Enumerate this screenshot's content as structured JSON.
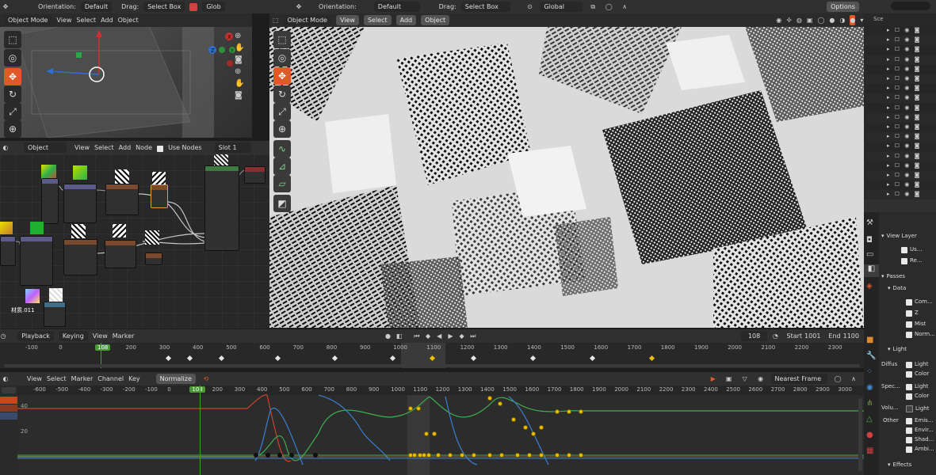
{
  "top_left_header": {
    "orientation_label": "Orientation:",
    "orientation_value": "Default",
    "drag_label": "Drag:",
    "drag_value": "Select Box",
    "transform_value": "Glob"
  },
  "top_right_header": {
    "orientation_label": "Orientation:",
    "orientation_value": "Default",
    "drag_label": "Drag:",
    "drag_value": "Select Box",
    "transform_value": "Global",
    "options_label": "Options"
  },
  "viewport_small": {
    "mode": "Object Mode",
    "menu": [
      "View",
      "Select",
      "Add",
      "Object"
    ]
  },
  "viewport_main": {
    "mode": "Object Mode",
    "menu": [
      "View",
      "Select",
      "Add",
      "Object"
    ]
  },
  "node_editor": {
    "mode": "Object",
    "menu": [
      "View",
      "Select",
      "Add",
      "Node"
    ],
    "use_nodes_label": "Use Nodes",
    "slot": "Slot 1",
    "material_label": "材质.011"
  },
  "timeline": {
    "menu": [
      "Playback",
      "Keying",
      "View",
      "Marker"
    ],
    "current_frame": "108",
    "start_label": "Start",
    "start_value": "1001",
    "end_label": "End",
    "end_value": "1100",
    "ticks": [
      "-100",
      "0",
      "108",
      "200",
      "300",
      "400",
      "500",
      "600",
      "700",
      "800",
      "900",
      "1000",
      "1100",
      "1200",
      "1300",
      "1400",
      "1500",
      "1600",
      "1700",
      "1800",
      "1900",
      "2000",
      "2100",
      "2200",
      "2300"
    ]
  },
  "graph_editor": {
    "menu": [
      "View",
      "Select",
      "Marker",
      "Channel",
      "Key"
    ],
    "normalize_label": "Normalize",
    "snap_value": "Nearest Frame",
    "current_frame": "108",
    "ticks": [
      "-600",
      "-500",
      "-400",
      "-300",
      "-200",
      "-100",
      "0",
      "108",
      "200",
      "300",
      "400",
      "500",
      "600",
      "700",
      "800",
      "900",
      "1000",
      "1100",
      "1200",
      "1300",
      "1400",
      "1500",
      "1600",
      "1700",
      "1800",
      "1900",
      "2000",
      "2100",
      "2200",
      "2300",
      "2400",
      "2500",
      "2600",
      "2700",
      "2800",
      "2900",
      "3000"
    ],
    "y_labels": [
      "40",
      "20"
    ]
  },
  "outliner": {
    "scene_label": "Sce"
  },
  "properties": {
    "view_layer_title": "View Layer",
    "view_layer_items": [
      "Us...",
      "Re..."
    ],
    "passes_title": "Passes",
    "data_title": "Data",
    "data_items": [
      "Com...",
      "Z",
      "Mist",
      "Norm..."
    ],
    "light_title": "Light",
    "diffuse_label": "Diffus",
    "diffuse_items": [
      "Light",
      "Color"
    ],
    "specular_label": "Spec...",
    "specular_items": [
      "Light",
      "Color"
    ],
    "volume_label": "Volu...",
    "volume_items": [
      "Light"
    ],
    "other_label": "Other",
    "other_items": [
      "Emis...",
      "Envir...",
      "Shad...",
      "Ambi..."
    ],
    "effects_title": "Effects"
  },
  "colors": {
    "accent": "#e05a28",
    "frame_marker": "#4a9a33",
    "key_yellow": "#e8c000",
    "curve_green": "#3fae4f",
    "curve_blue": "#3b7fd0",
    "curve_red": "#c8442a"
  }
}
